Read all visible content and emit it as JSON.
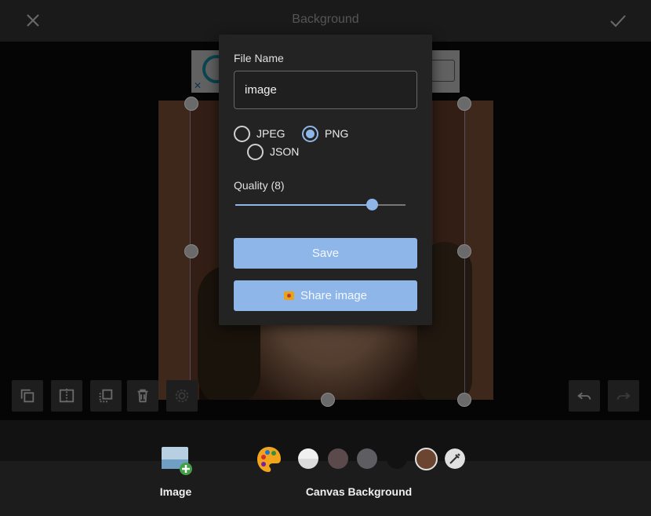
{
  "header": {
    "title": "Background",
    "close_icon": "close-icon",
    "confirm_icon": "check-icon"
  },
  "dialog": {
    "file_name_label": "File Name",
    "file_name_value": "image",
    "formats": [
      {
        "label": "JPEG",
        "checked": false
      },
      {
        "label": "PNG",
        "checked": true
      },
      {
        "label": "JSON",
        "checked": false
      }
    ],
    "quality_label": "Quality (8)",
    "quality_value": 0.8,
    "save_label": "Save",
    "share_label": "Share image",
    "share_icon": "camera-icon"
  },
  "toolbar": {
    "tools": [
      "duplicate-icon",
      "flip-icon",
      "send-back-icon",
      "trash-icon",
      "settings-icon"
    ],
    "undo_icon": "undo-icon",
    "redo_icon": "redo-icon"
  },
  "bottom": {
    "image_label": "Image",
    "canvas_background_label": "Canvas Background",
    "swatches": [
      "#f0f0f0",
      "#5a4a4c",
      "#5e5e62",
      "#121212",
      "#6b4530"
    ],
    "accent": "#8fb6e8"
  }
}
